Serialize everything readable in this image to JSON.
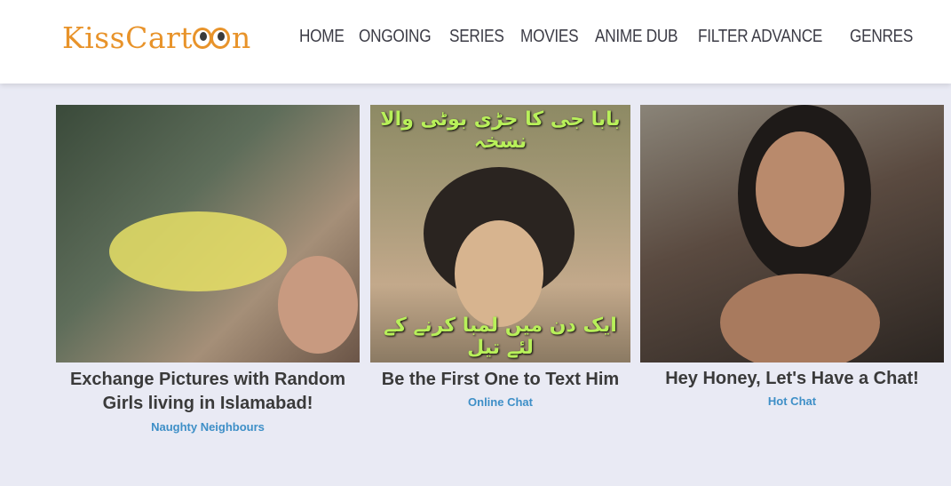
{
  "logo": {
    "text_prefix": "KissCart",
    "text_suffix": "n"
  },
  "nav": [
    "HOME",
    "ONGOING",
    "SERIES",
    "MOVIES",
    "ANIME DUB",
    "FILTER ADVANCE",
    "GENRES"
  ],
  "ads": [
    {
      "title": "Exchange Pictures with Random Girls living in Islamabad!",
      "source": "Naughty Neighbours"
    },
    {
      "title": "Be the First One to Text Him",
      "source": "Online Chat",
      "overlay_top": "بابا جی کا جڑی بوٹی والا نسخہ",
      "overlay_bottom": "ایک دن میں لمبا کرنے کے لئے تیل"
    },
    {
      "title": "Hey Honey, Let's Have a Chat!",
      "source": "Hot Chat"
    }
  ],
  "colors": {
    "brand": "#e8932a",
    "link": "#3e8fc7",
    "background": "#e9eaf4"
  }
}
